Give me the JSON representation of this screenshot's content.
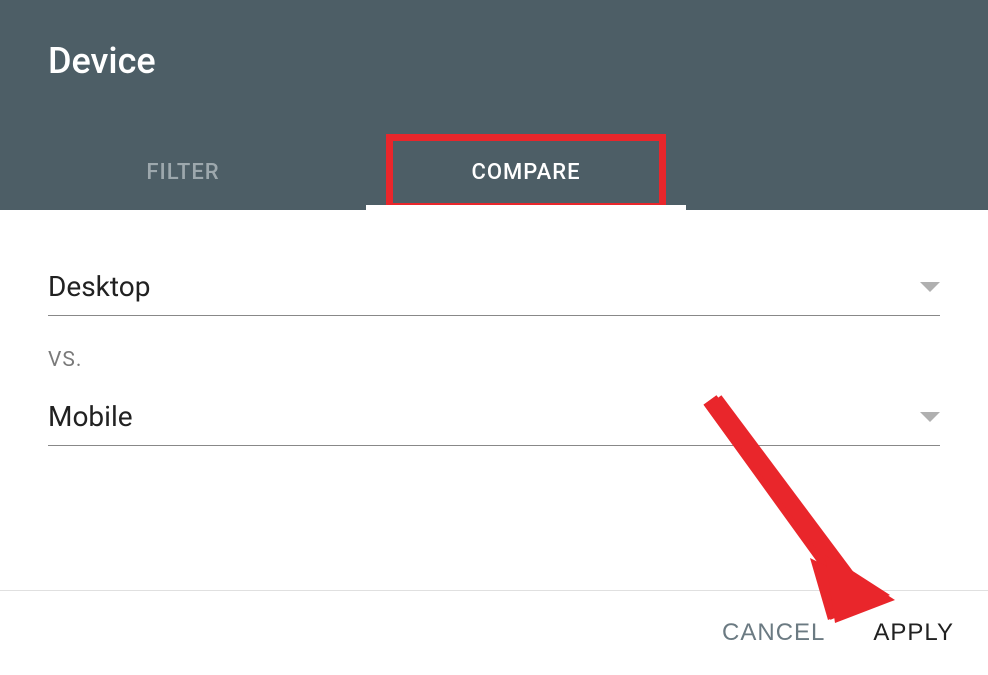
{
  "header": {
    "title": "Device"
  },
  "tabs": {
    "filter": "FILTER",
    "compare": "COMPARE",
    "active": "compare"
  },
  "compare": {
    "first_value": "Desktop",
    "vs_label": "VS.",
    "second_value": "Mobile"
  },
  "footer": {
    "cancel": "CANCEL",
    "apply": "APPLY"
  },
  "annotation": {
    "compare_highlight": true,
    "apply_arrow": true,
    "highlight_color": "#e9262b"
  }
}
